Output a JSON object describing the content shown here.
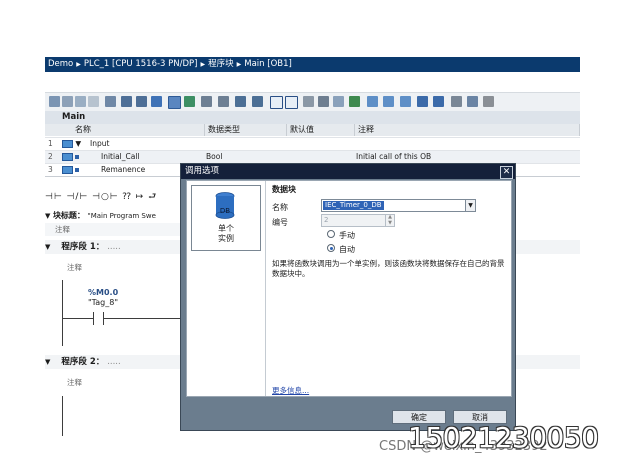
{
  "breadcrumb": [
    "Demo",
    "PLC_1 [CPU 1516-3 PN/DP]",
    "程序块",
    "Main [OB1]"
  ],
  "block_name": "Main",
  "interface": {
    "headers": [
      "名称",
      "数据类型",
      "默认值",
      "注释"
    ],
    "rows": [
      {
        "num": "1",
        "name": "Input",
        "type": "",
        "default": "",
        "comment": ""
      },
      {
        "num": "2",
        "name": "Initial_Call",
        "type": "Bool",
        "default": "",
        "comment": "Initial call of this OB"
      },
      {
        "num": "3",
        "name": "Remanence",
        "type": "",
        "default": "",
        "comment": ""
      }
    ]
  },
  "lad_toolbar": "⊣⊢ ⊣/⊢ ⊣○⊢ ⁇ ↦ ⮐",
  "block_title_label": "块标题：",
  "block_title_value": "\"Main Program Swe",
  "comment_label": "注释",
  "networks": [
    {
      "title": "程序段 1：",
      "dots": ".....",
      "comment": "注释",
      "contact_addr": "%M0.0",
      "contact_tag": "\"Tag_8\""
    },
    {
      "title": "程序段 2：",
      "dots": ".....",
      "comment": "注释"
    }
  ],
  "dialog": {
    "title": "调用选项",
    "tile_label": "单个\n实例",
    "db_icon_text": "DB",
    "section_title": "数据块",
    "name_label": "名称",
    "name_value": "IEC_Timer_0_DB",
    "number_label": "编号",
    "number_value": "2",
    "radio_manual": "手动",
    "radio_auto": "自动",
    "selected_radio": "自动",
    "description": "如果将函数块调用为一个单实例，则该函数块将数据保存在自己的背景数据块中。",
    "more_info": "更多信息...",
    "ok": "确定",
    "cancel": "取消"
  },
  "watermark": {
    "phone": "15021230050",
    "csdn": "CSDN @weixin_43932392"
  }
}
